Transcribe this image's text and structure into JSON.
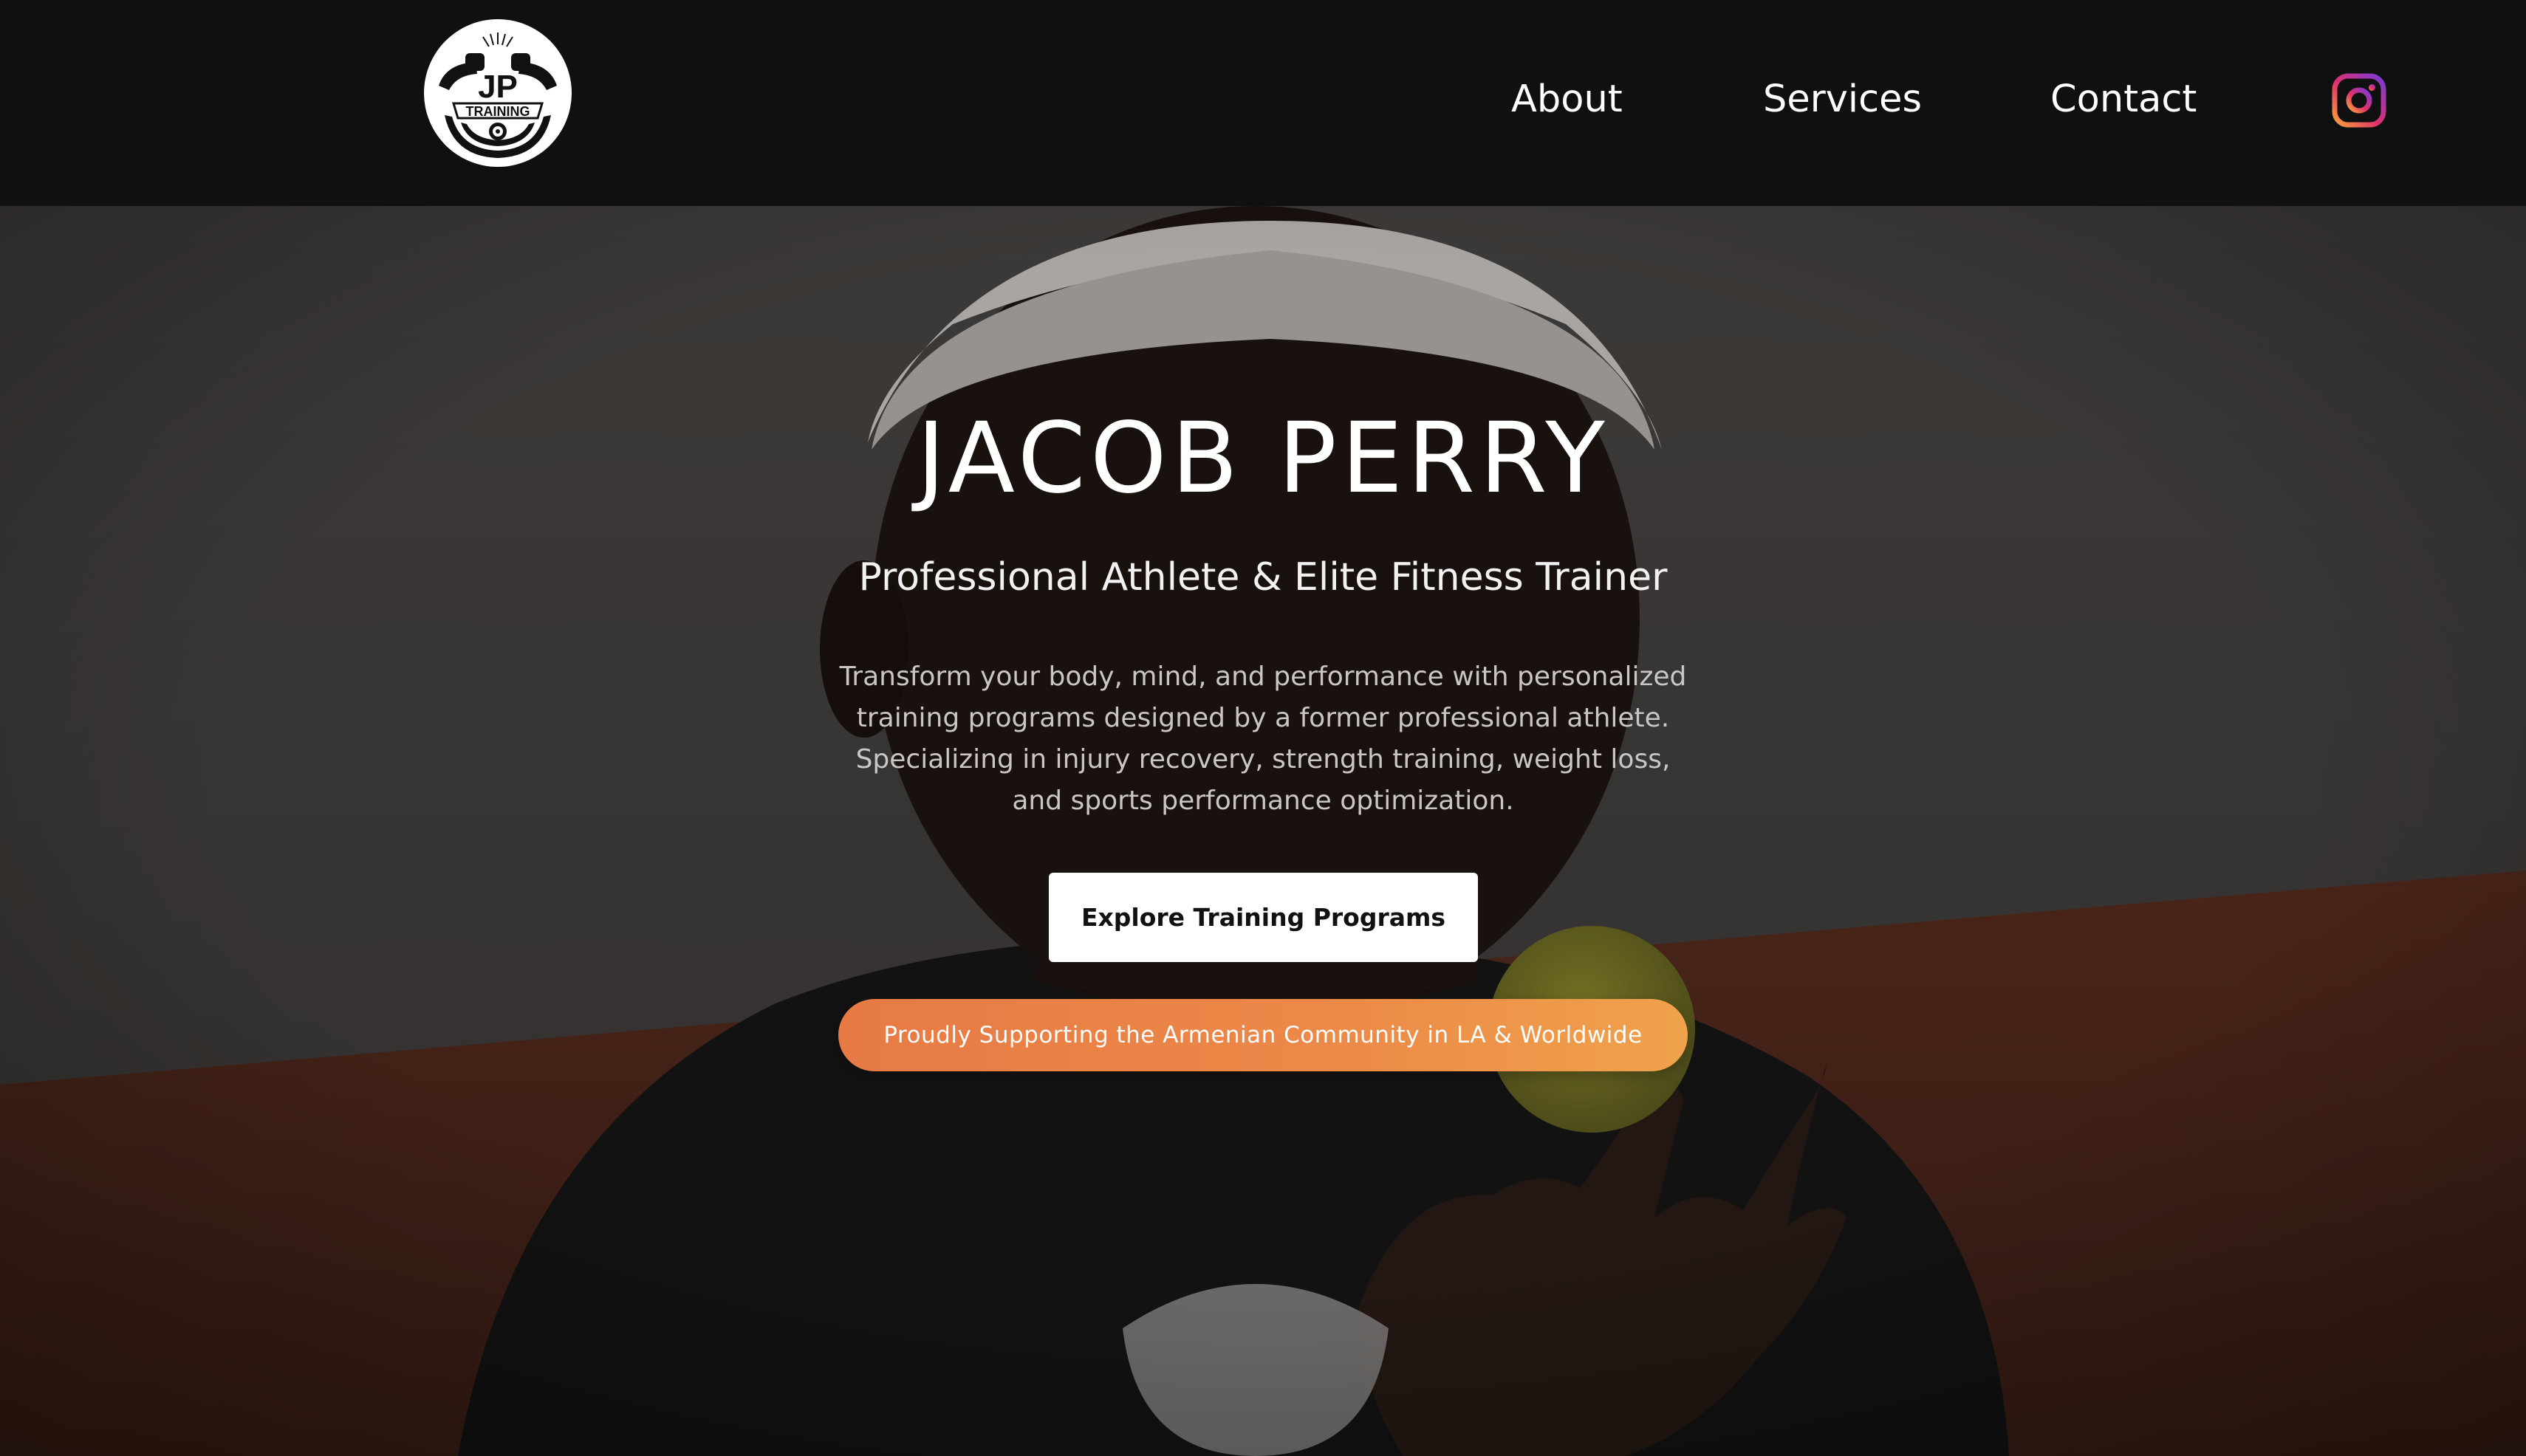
{
  "header": {
    "logo": {
      "top_text": "JP",
      "ring_text": "TRAINING"
    },
    "nav": [
      {
        "label": "About"
      },
      {
        "label": "Services"
      },
      {
        "label": "Contact"
      }
    ],
    "social_icon": "instagram-icon"
  },
  "hero": {
    "title": "JACOB PERRY",
    "subtitle": "Professional Athlete & Elite Fitness Trainer",
    "description": "Transform your body, mind, and performance with personalized training programs designed by a former professional athlete. Specializing in injury recovery, strength training, weight loss, and sports performance optimization.",
    "cta_label": "Explore Training Programs",
    "badge_text": "Proudly Supporting the Armenian Community in LA & Worldwide"
  },
  "colors": {
    "header_bg": "#101010",
    "badge_gradient_start": "#e77a45",
    "badge_gradient_end": "#f0a24c",
    "cta_bg": "#ffffff"
  }
}
